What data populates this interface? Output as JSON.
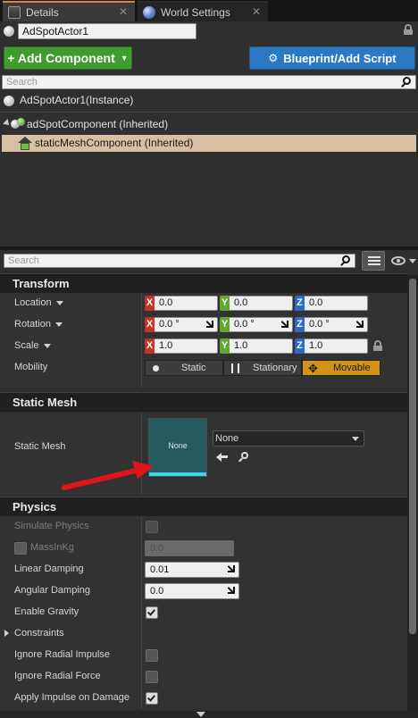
{
  "tabs": [
    {
      "label": "Details",
      "active": true
    },
    {
      "label": "World Settings",
      "active": false
    }
  ],
  "actor": {
    "name": "AdSpotActor1"
  },
  "toolbar": {
    "add_component": "+ Add Component",
    "blueprint": "Blueprint/Add Script"
  },
  "component_search": {
    "placeholder": "Search"
  },
  "components": {
    "instance": "AdSpotActor1(Instance)",
    "items": [
      "adSpotComponent (Inherited)",
      "staticMeshComponent (Inherited)"
    ],
    "selected": "staticMeshComponent (Inherited)"
  },
  "details_search": {
    "placeholder": "Search"
  },
  "transform": {
    "title": "Transform",
    "location": {
      "label": "Location",
      "x": "0.0",
      "y": "0.0",
      "z": "0.0"
    },
    "rotation": {
      "label": "Rotation",
      "x": "0.0 °",
      "y": "0.0 °",
      "z": "0.0 °"
    },
    "scale": {
      "label": "Scale",
      "x": "1.0",
      "y": "1.0",
      "z": "1.0"
    },
    "mobility": {
      "label": "Mobility",
      "options": [
        "Static",
        "Stationary",
        "Movable"
      ],
      "selected": "Movable"
    },
    "axis_tags": {
      "x": "X",
      "y": "Y",
      "z": "Z"
    }
  },
  "static_mesh": {
    "title": "Static Mesh",
    "label": "Static Mesh",
    "thumbnail_label": "None",
    "selected_value": "None"
  },
  "physics": {
    "title": "Physics",
    "simulate_physics": {
      "label": "Simulate Physics",
      "checked": false,
      "enabled": false
    },
    "mass_in_kg": {
      "label": "MassInKg",
      "value": "0.0",
      "enabled": false
    },
    "linear_damping": {
      "label": "Linear Damping",
      "value": "0.01"
    },
    "angular_damping": {
      "label": "Angular Damping",
      "value": "0.0"
    },
    "enable_gravity": {
      "label": "Enable Gravity",
      "checked": true
    },
    "constraints": {
      "label": "Constraints"
    },
    "ignore_radial_impulse": {
      "label": "Ignore Radial Impulse",
      "checked": false
    },
    "ignore_radial_force": {
      "label": "Ignore Radial Force",
      "checked": false
    },
    "apply_impulse_on_damage": {
      "label": "Apply Impulse on Damage",
      "checked": true
    }
  },
  "colors": {
    "accent_tab": "#d58a2b",
    "add_component": "#3f9b2e",
    "blueprint": "#2a79c2",
    "selected_row": "#d7c0a2",
    "movable_selected": "#cf9418",
    "mesh_thumb": "#245a5e",
    "axis_x": "#c3352b",
    "axis_y": "#61a82c",
    "axis_z": "#2d6ac7",
    "annotation_arrow": "#e0141a"
  },
  "annotation": {
    "type": "red-arrow",
    "target": "static-mesh-thumbnail"
  }
}
